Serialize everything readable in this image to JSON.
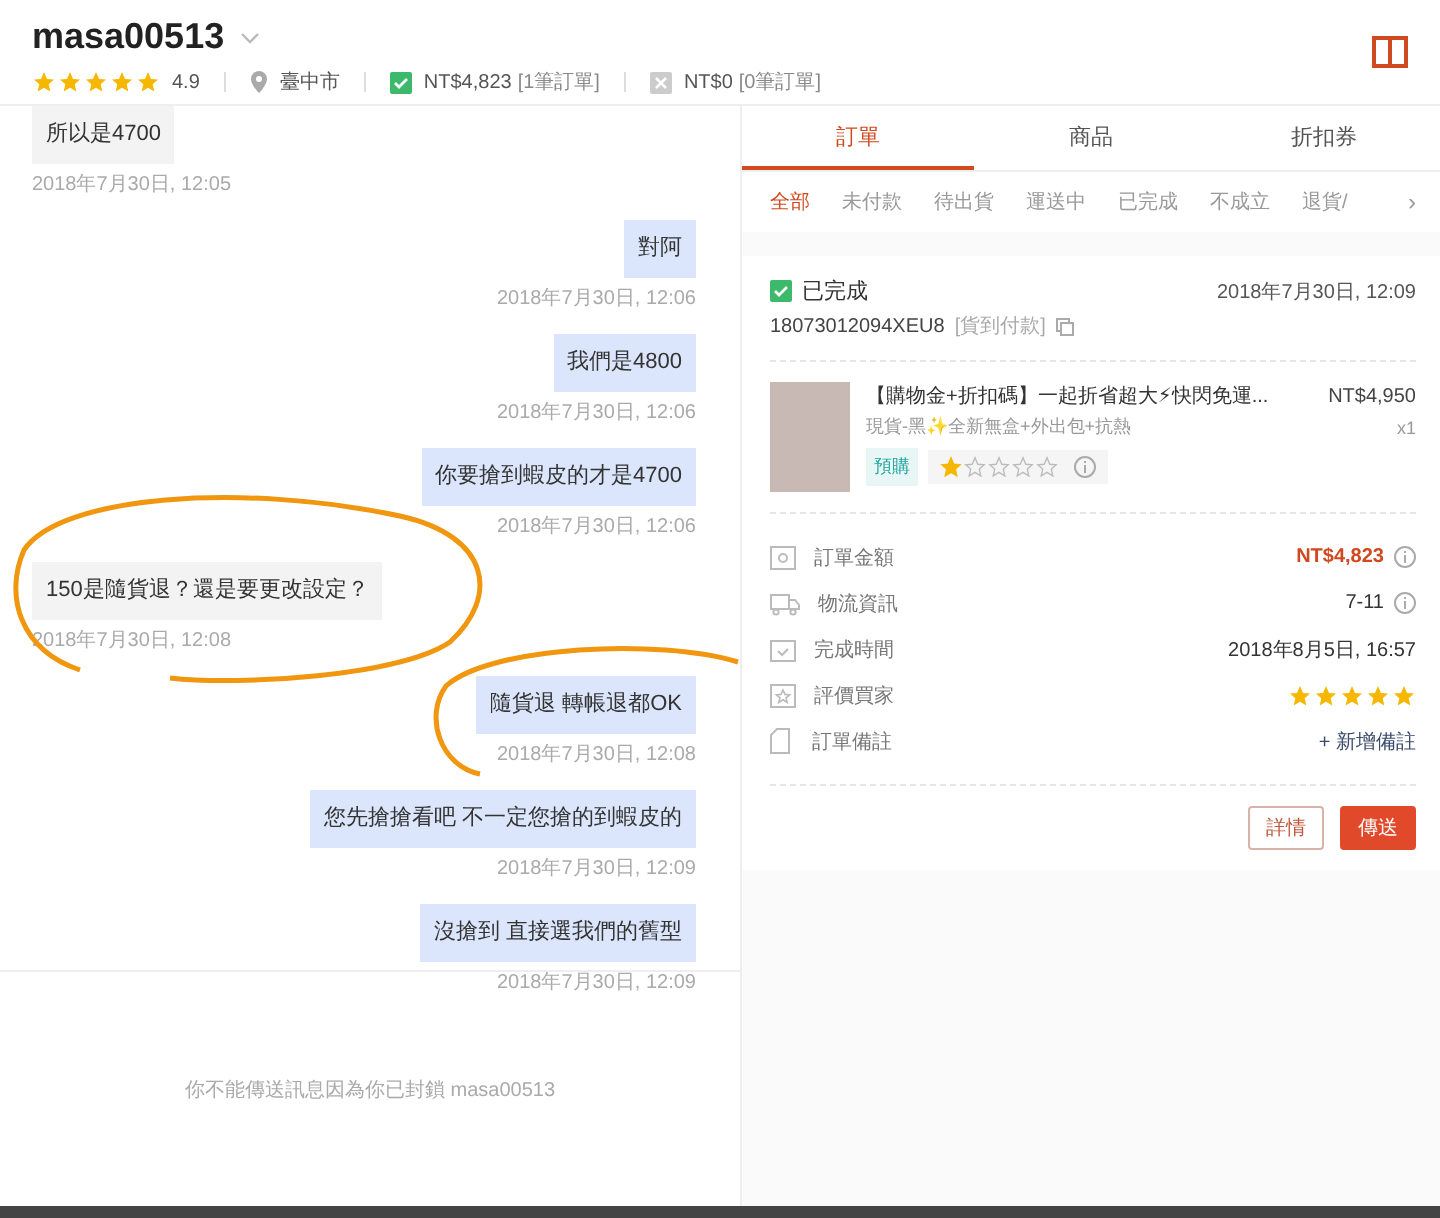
{
  "header": {
    "username": "masa00513",
    "stars": 5,
    "rating": "4.9",
    "location": "臺中市",
    "paid": {
      "amount": "NT$4,823",
      "count": "[1筆訂單]"
    },
    "unpaid": {
      "amount": "NT$0",
      "count": "[0筆訂單]"
    }
  },
  "messages": [
    {
      "kind": "received",
      "text": "所以是4700",
      "time": "2018年7月30日, 12:05"
    },
    {
      "kind": "sent",
      "text": "對阿",
      "time": "2018年7月30日, 12:06"
    },
    {
      "kind": "sent",
      "text": "我們是4800",
      "time": "2018年7月30日, 12:06"
    },
    {
      "kind": "sent",
      "text": "你要搶到蝦皮的才是4700",
      "time": "2018年7月30日, 12:06"
    },
    {
      "kind": "received",
      "text": "150是隨貨退？還是要更改設定？",
      "time": "2018年7月30日, 12:08"
    },
    {
      "kind": "sent",
      "text": "隨貨退 轉帳退都OK",
      "time": "2018年7月30日, 12:08"
    },
    {
      "kind": "sent",
      "text": "您先搶搶看吧 不一定您搶的到蝦皮的",
      "time": "2018年7月30日, 12:09"
    },
    {
      "kind": "sent",
      "text": "沒搶到 直接選我們的舊型",
      "time": "2018年7月30日, 12:09"
    }
  ],
  "notice": "你不能傳送訊息因為你已封鎖 masa00513",
  "tabs": [
    {
      "label": "訂單",
      "selected": true
    },
    {
      "label": "商品",
      "selected": false
    },
    {
      "label": "折扣券",
      "selected": false
    }
  ],
  "subtabs": [
    {
      "label": "全部",
      "selected": true
    },
    {
      "label": "未付款",
      "selected": false
    },
    {
      "label": "待出貨",
      "selected": false
    },
    {
      "label": "運送中",
      "selected": false
    },
    {
      "label": "已完成",
      "selected": false
    },
    {
      "label": "不成立",
      "selected": false
    },
    {
      "label": "退貨/",
      "selected": false
    }
  ],
  "subtabs_more": "›",
  "order": {
    "status": "已完成",
    "time": "2018年7月30日, 12:09",
    "order_id": "18073012094XEU8",
    "payment": "[貨到付款]",
    "product": {
      "title": "【購物金+折扣碼】一起折省超大⚡快閃免運...",
      "variant": "現貨-黑✨全新無盒+外出包+抗熱",
      "price": "NT$4,950",
      "quantity": "x1",
      "tag": "預購",
      "stars": 1
    },
    "details": [
      {
        "kind": "amount",
        "label": "訂單金額",
        "value": "NT$4,823"
      },
      {
        "kind": "info",
        "label": "物流資訊",
        "value": "7-11"
      },
      {
        "kind": "text",
        "label": "完成時間",
        "value": "2018年8月5日, 16:57"
      },
      {
        "kind": "stars",
        "label": "評價買家",
        "stars": 5
      },
      {
        "kind": "link",
        "label": "訂單備註",
        "value": "+ 新增備註"
      }
    ],
    "buttons": [
      {
        "kind": "outline",
        "label": "詳情"
      },
      {
        "kind": "primary",
        "label": "傳送"
      }
    ]
  }
}
